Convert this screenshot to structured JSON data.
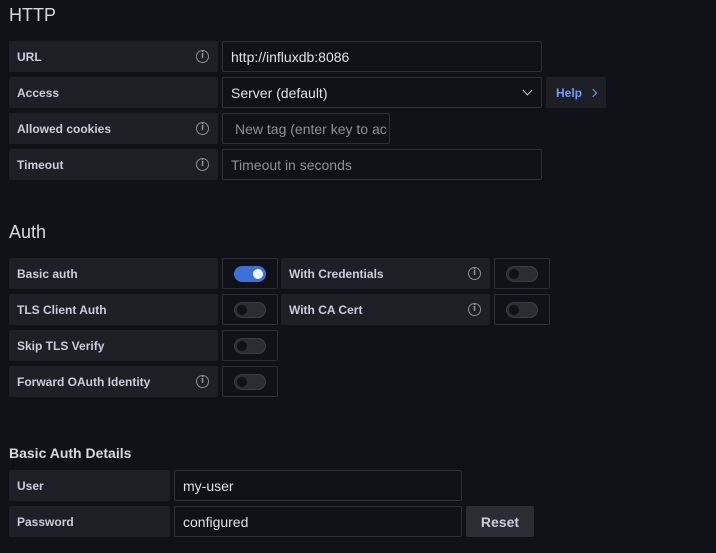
{
  "http": {
    "title": "HTTP",
    "url": {
      "label": "URL",
      "value": "http://influxdb:8086"
    },
    "access": {
      "label": "Access",
      "value": "Server (default)",
      "help_label": "Help"
    },
    "allowed_cookies": {
      "label": "Allowed cookies",
      "placeholder": "New tag (enter key to ac"
    },
    "timeout": {
      "label": "Timeout",
      "placeholder": "Timeout in seconds"
    }
  },
  "auth": {
    "title": "Auth",
    "basic_auth": {
      "label": "Basic auth",
      "enabled": true
    },
    "with_credentials": {
      "label": "With Credentials",
      "enabled": false
    },
    "tls_client_auth": {
      "label": "TLS Client Auth",
      "enabled": false
    },
    "with_ca_cert": {
      "label": "With CA Cert",
      "enabled": false
    },
    "skip_tls_verify": {
      "label": "Skip TLS Verify",
      "enabled": false
    },
    "forward_oauth": {
      "label": "Forward OAuth Identity",
      "enabled": false
    }
  },
  "basic_auth_details": {
    "title": "Basic Auth Details",
    "user": {
      "label": "User",
      "value": "my-user"
    },
    "password": {
      "label": "Password",
      "value": "configured",
      "reset_label": "Reset"
    }
  },
  "icons": {
    "info": "info-circle-icon",
    "chevron": "chevron-down-icon",
    "help_chevron": "chevron-right-icon"
  },
  "colors": {
    "background": "#111217",
    "label_bg": "#1f2026",
    "accent": "#3d71d9",
    "link": "#6e9fff"
  }
}
